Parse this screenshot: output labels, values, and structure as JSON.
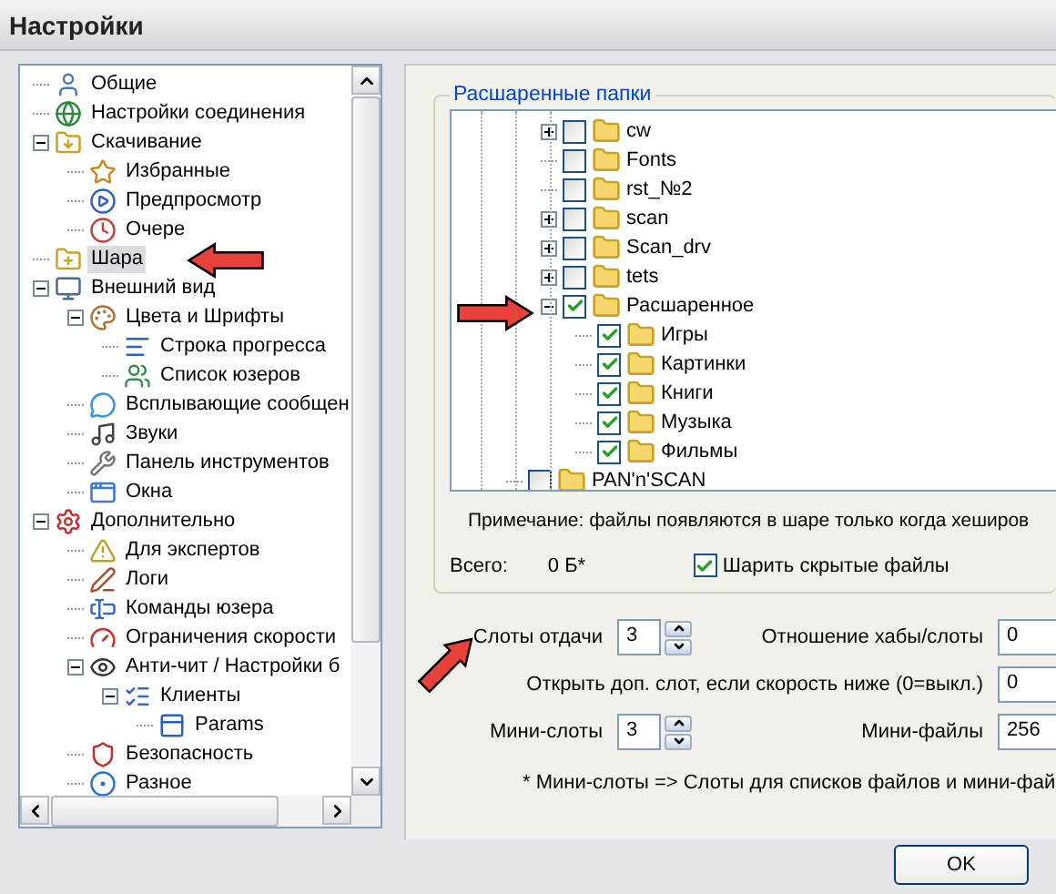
{
  "window": {
    "title": "Настройки"
  },
  "nav_tree": [
    {
      "label": "Общие",
      "selected": false
    },
    {
      "label": "Настройки соединения",
      "selected": false
    },
    {
      "label": "Скачивание",
      "selected": false,
      "expanded": true,
      "children": [
        {
          "label": "Избранные",
          "selected": false
        },
        {
          "label": "Предпросмотр",
          "selected": false
        },
        {
          "label": "Очере",
          "selected": false
        }
      ]
    },
    {
      "label": "Шара",
      "selected": true
    },
    {
      "label": "Внешний вид",
      "selected": false,
      "expanded": true,
      "children": [
        {
          "label": "Цвета и Шрифты",
          "selected": false,
          "expanded": true,
          "children": [
            {
              "label": "Строка прогресса",
              "selected": false
            },
            {
              "label": "Список юзеров",
              "selected": false
            }
          ]
        },
        {
          "label": "Всплывающие сообщен",
          "selected": false
        },
        {
          "label": "Звуки",
          "selected": false
        },
        {
          "label": "Панель инструментов",
          "selected": false
        },
        {
          "label": "Окна",
          "selected": false
        }
      ]
    },
    {
      "label": "Дополнительно",
      "selected": false,
      "expanded": true,
      "children": [
        {
          "label": "Для экспертов",
          "selected": false
        },
        {
          "label": "Логи",
          "selected": false
        },
        {
          "label": "Команды юзера",
          "selected": false
        },
        {
          "label": "Ограничения скорости",
          "selected": false
        },
        {
          "label": "Анти-чит / Настройки б",
          "selected": false,
          "expanded": true,
          "children": [
            {
              "label": "Клиенты",
              "selected": false,
              "expanded": true,
              "children": [
                {
                  "label": "Params",
                  "selected": false
                }
              ]
            }
          ]
        },
        {
          "label": "Безопасность",
          "selected": false
        },
        {
          "label": "Разное",
          "selected": false
        }
      ]
    }
  ],
  "shared_folders": {
    "title": "Расшаренные папки",
    "folders": [
      {
        "children": [
          {
            "label": "cw",
            "checked": false,
            "expanded": false
          },
          {
            "label": "Fonts",
            "checked": false
          },
          {
            "label": "rst_№2",
            "checked": false
          },
          {
            "label": "scan",
            "checked": false,
            "expanded": false
          },
          {
            "label": "Scan_drv",
            "checked": false,
            "expanded": false
          },
          {
            "label": "tets",
            "checked": false,
            "expanded": false
          },
          {
            "label": "Расшаренное",
            "checked": true,
            "expanded": true,
            "children": [
              {
                "label": "Игры",
                "checked": true
              },
              {
                "label": "Картинки",
                "checked": true
              },
              {
                "label": "Книги",
                "checked": true
              },
              {
                "label": "Музыка",
                "checked": true
              },
              {
                "label": "Фильмы",
                "checked": true
              }
            ]
          }
        ]
      },
      {
        "label": "PAN'n'SCAN",
        "checked": false
      }
    ],
    "note": "Примечание: файлы появляются в шаре только когда хеширов",
    "total_label": "Всего:",
    "total_value": "0 Б*",
    "hidden_files": {
      "label": "Шарить скрытые файлы",
      "checked": true
    }
  },
  "settings": [
    {
      "kind": "spinner",
      "label": "Слоты отдачи",
      "value": "3"
    },
    {
      "kind": "field",
      "label": "Отношение хабы/слоты",
      "value": "0"
    },
    {
      "kind": "wide",
      "label": "Открыть доп. слот, если скорость ниже (0=выкл.)",
      "value": "0"
    },
    {
      "kind": "spinner",
      "label": "Мини-слоты",
      "value": "3"
    },
    {
      "kind": "field",
      "label": "Мини-файлы",
      "value": "256"
    }
  ],
  "footnote": "* Мини-слоты => Слоты для списков файлов и мини-фай",
  "buttons": [
    "OK"
  ]
}
